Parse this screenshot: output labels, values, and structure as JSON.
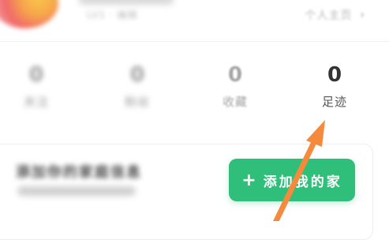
{
  "profile": {
    "name_blurred": "",
    "subtitle_blurred": "LV1 · 编辑",
    "homepage_link": "个人主页",
    "chevron_icon": "chevron-right-icon"
  },
  "stats": [
    {
      "id": "follow",
      "value": "0",
      "label": "关注"
    },
    {
      "id": "fans",
      "value": "0",
      "label": "粉丝"
    },
    {
      "id": "favorites",
      "value": "0",
      "label": "收藏"
    },
    {
      "id": "footprint",
      "value": "0",
      "label": "足迹"
    }
  ],
  "card": {
    "title_blurred": "添加你的家庭信息",
    "add_home_button": "添加我的家",
    "plus_icon": "plus-icon",
    "button_color": "#2fbf7a"
  },
  "annotation": {
    "arrow_color": "#f58a3c",
    "arrow_icon": "arrow-pointer-annotation"
  }
}
